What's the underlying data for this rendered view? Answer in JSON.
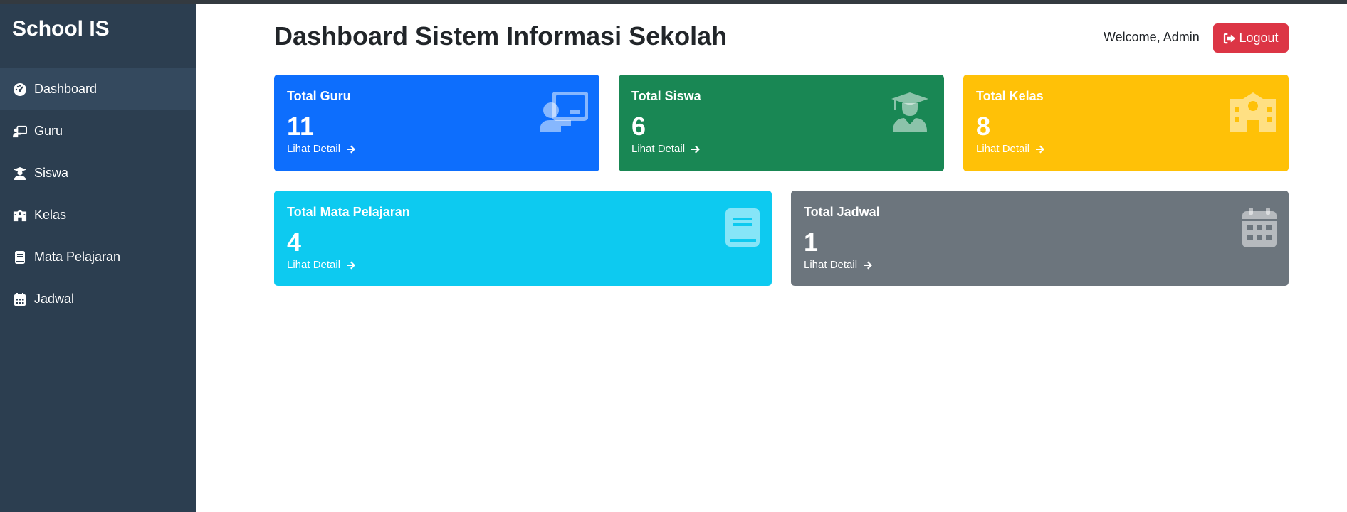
{
  "app": {
    "brand": "School IS"
  },
  "sidebar": {
    "items": [
      {
        "label": "Dashboard",
        "icon": "dashboard-icon",
        "active": true
      },
      {
        "label": "Guru",
        "icon": "chalkboard-teacher-icon"
      },
      {
        "label": "Siswa",
        "icon": "user-graduate-icon"
      },
      {
        "label": "Kelas",
        "icon": "school-icon"
      },
      {
        "label": "Mata Pelajaran",
        "icon": "book-icon"
      },
      {
        "label": "Jadwal",
        "icon": "calendar-icon"
      }
    ]
  },
  "header": {
    "title": "Dashboard Sistem Informasi Sekolah",
    "welcome": "Welcome, Admin",
    "logout_label": "Logout"
  },
  "cards": [
    {
      "label": "Total Guru",
      "value": "11",
      "link": "Lihat Detail",
      "color": "#0d6efd",
      "icon": "chalkboard-teacher-icon"
    },
    {
      "label": "Total Siswa",
      "value": "6",
      "link": "Lihat Detail",
      "color": "#198754",
      "icon": "user-graduate-icon"
    },
    {
      "label": "Total Kelas",
      "value": "8",
      "link": "Lihat Detail",
      "color": "#ffc107",
      "icon": "school-icon"
    },
    {
      "label": "Total Mata Pelajaran",
      "value": "4",
      "link": "Lihat Detail",
      "color": "#0dcaf0",
      "icon": "book-icon"
    },
    {
      "label": "Total Jadwal",
      "value": "1",
      "link": "Lihat Detail",
      "color": "#6c757d",
      "icon": "calendar-icon"
    }
  ],
  "colors": {
    "sidebar": "#2c3e50",
    "logout": "#dc3545"
  }
}
